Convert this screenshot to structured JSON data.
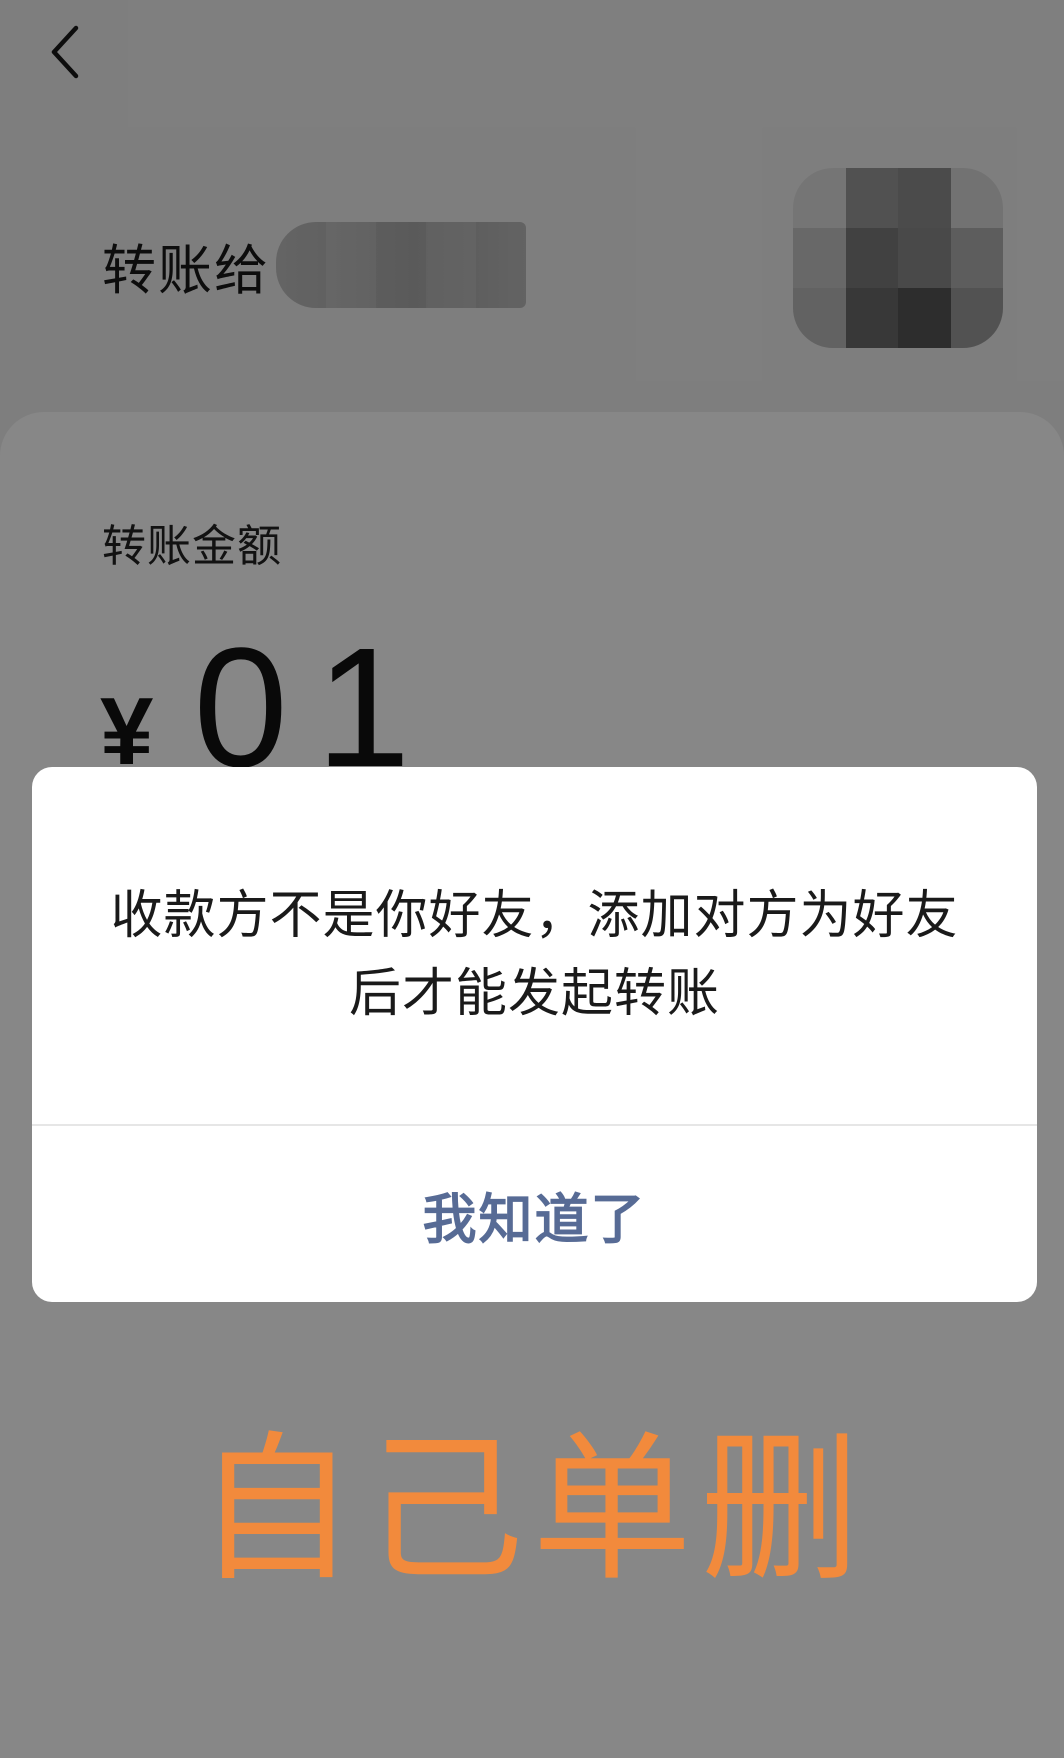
{
  "header": {
    "back_icon": "chevron-left-icon"
  },
  "recipient": {
    "label": "转账给"
  },
  "amount": {
    "label": "转账金额",
    "currency": "¥",
    "value": "01"
  },
  "dialog": {
    "message": "收款方不是你好友，添加对方为好友后才能发起转账",
    "button_label": "我知道了",
    "button_color": "#576b95"
  },
  "annotation": {
    "text": "自己单删",
    "color": "#f28a3c"
  }
}
